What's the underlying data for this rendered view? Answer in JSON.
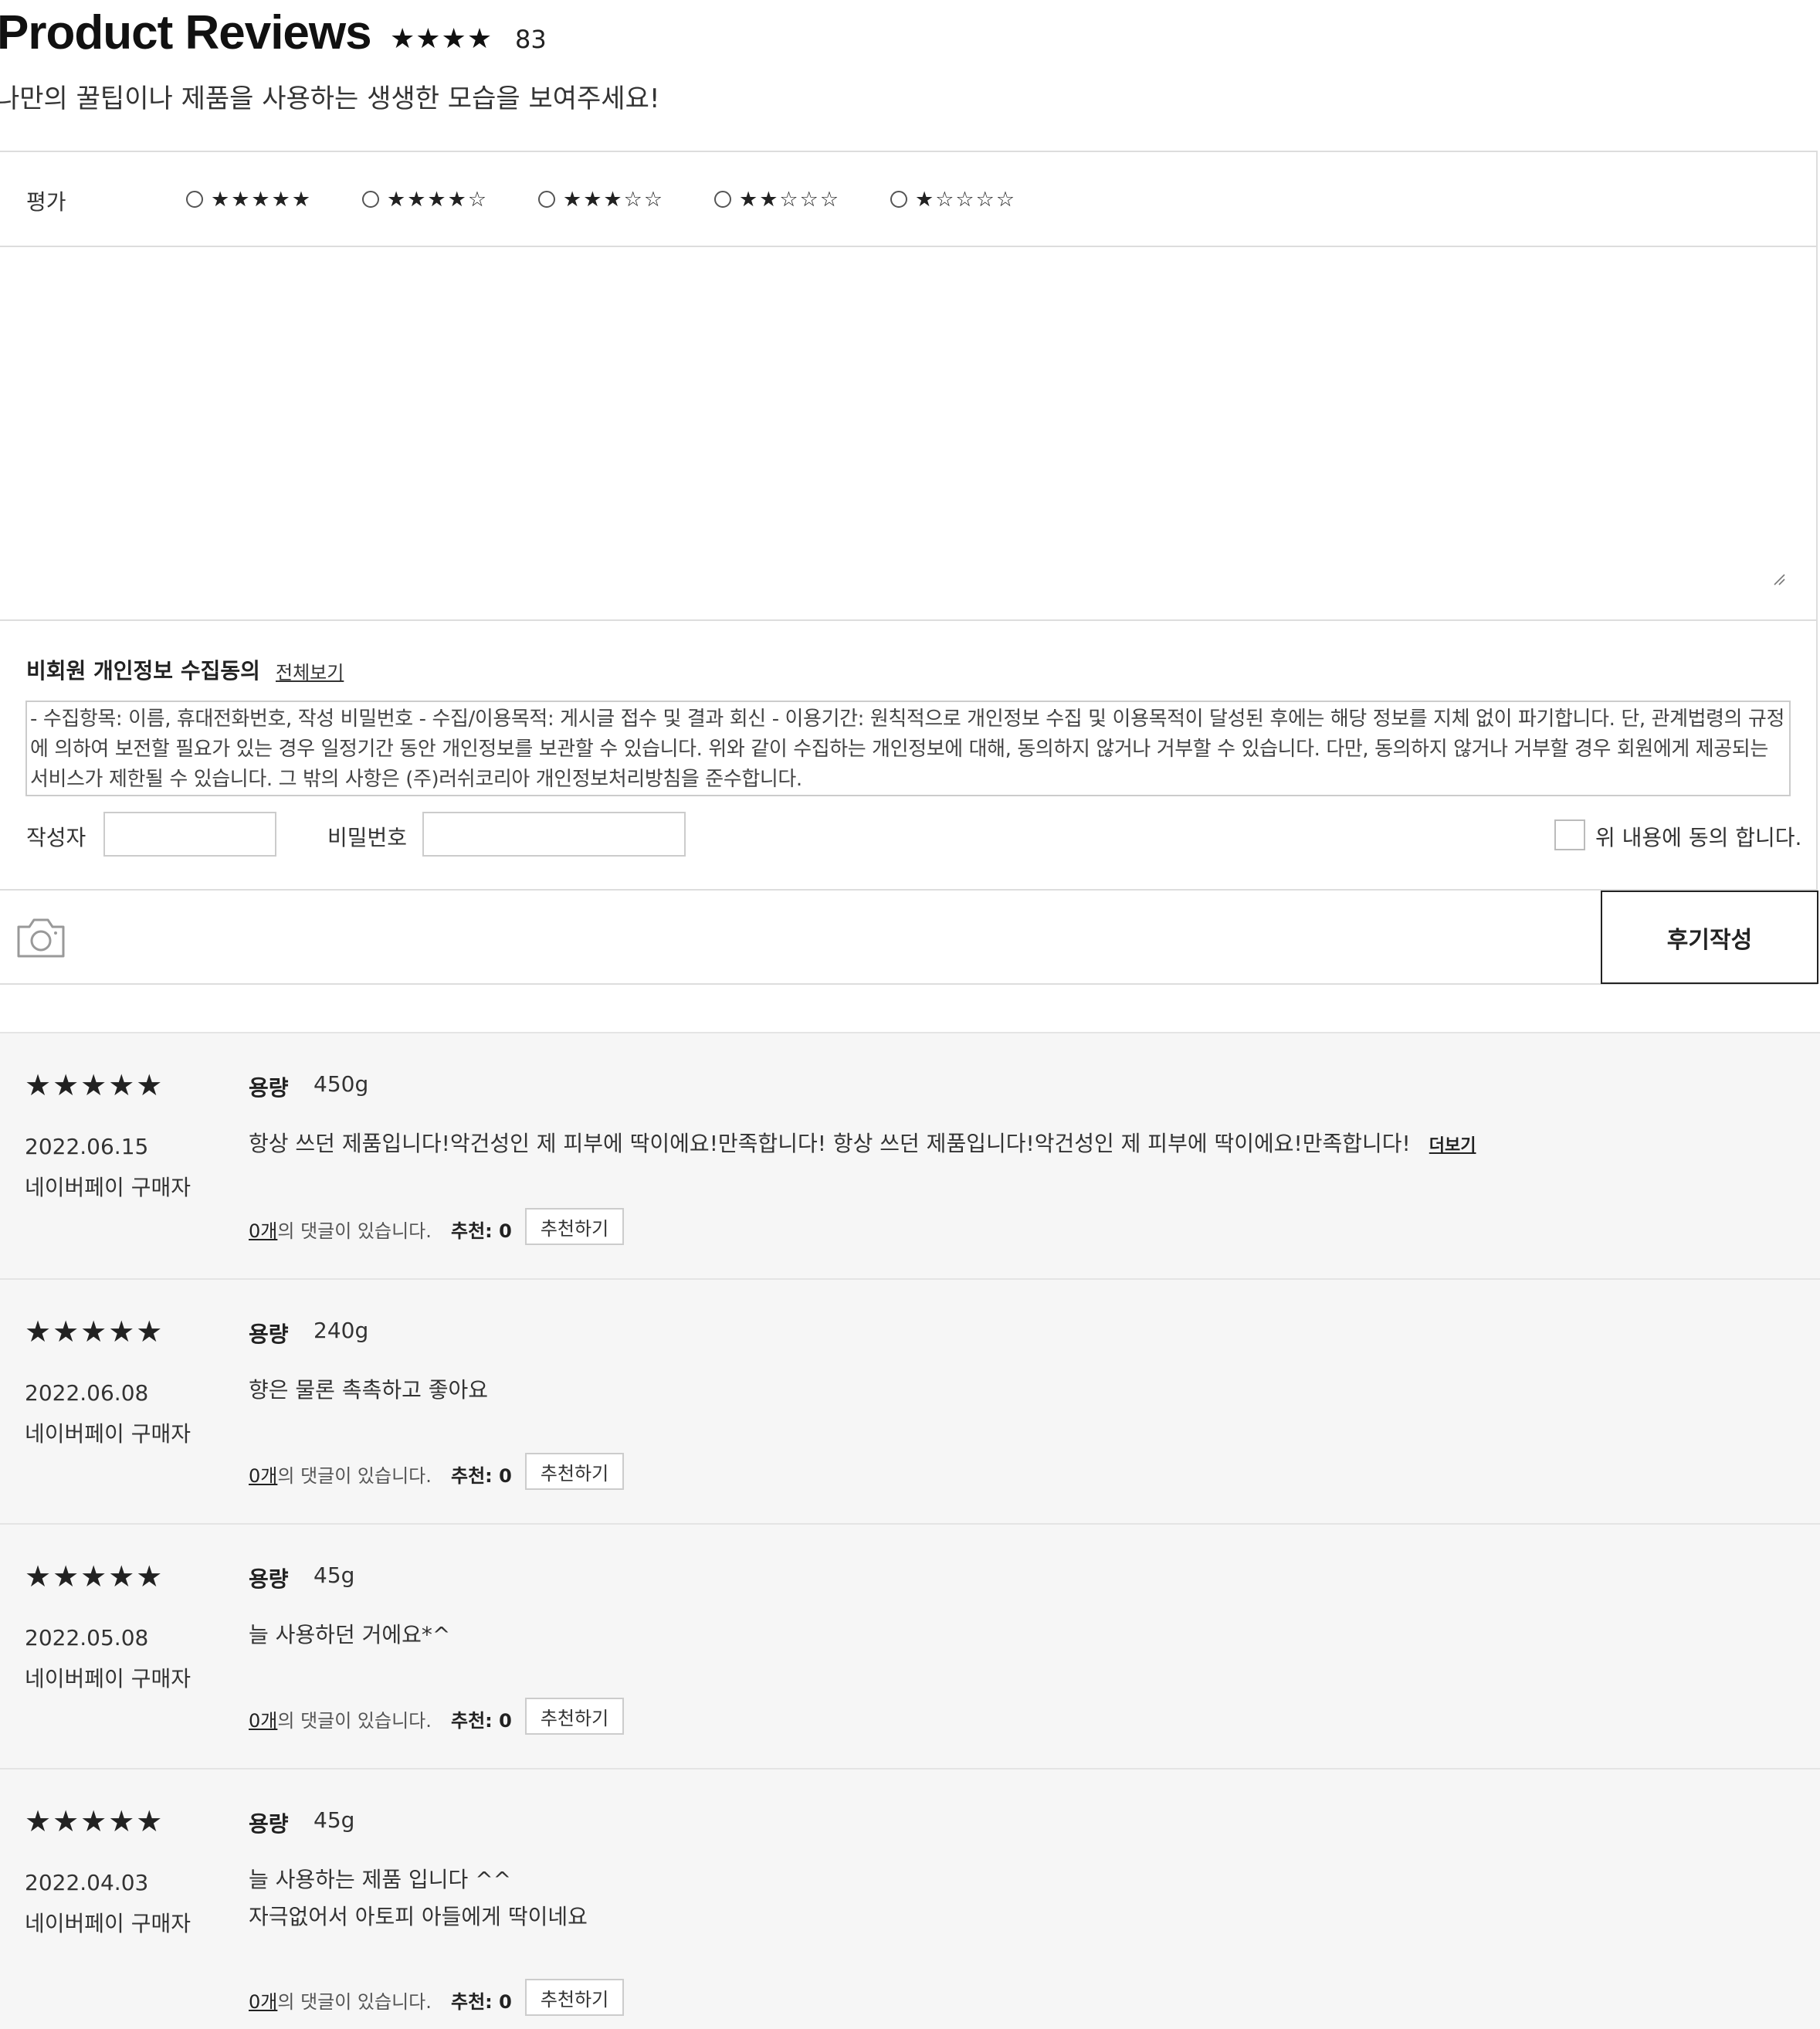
{
  "header": {
    "title": "Product Reviews",
    "rating_stars": "★★★★",
    "review_count": "83",
    "subtitle": "나만의 꿀팁이나 제품을 사용하는 생생한 모습을 보여주세요!"
  },
  "form": {
    "rating_label": "평가",
    "rating_options": [
      {
        "stars": "★★★★★"
      },
      {
        "stars": "★★★★☆"
      },
      {
        "stars": "★★★☆☆"
      },
      {
        "stars": "★★☆☆☆"
      },
      {
        "stars": "★☆☆☆☆"
      }
    ],
    "review_text_value": "",
    "consent_title": "비회원 개인정보 수집동의",
    "consent_view_all": "전체보기",
    "consent_text": "- 수집항목: 이름, 휴대전화번호, 작성 비밀번호 - 수집/이용목적: 게시글 접수 및 결과 회신 - 이용기간: 원칙적으로 개인정보 수집 및 이용목적이 달성된 후에는 해당 정보를 지체 없이 파기합니다. 단, 관계법령의 규정에 의하여 보전할 필요가 있는 경우 일정기간 동안 개인정보를 보관할 수 있습니다. 위와 같이 수집하는 개인정보에 대해, 동의하지 않거나 거부할 수 있습니다. 다만, 동의하지 않거나 거부할 경우 회원에게 제공되는 서비스가 제한될 수 있습니다. 그 밖의 사항은 (주)러쉬코리아 개인정보처리방침을 준수합니다.",
    "author_label": "작성자",
    "password_label": "비밀번호",
    "agree_label": "위 내용에 동의 합니다.",
    "camera_icon": "camera-icon",
    "submit_label": "후기작성"
  },
  "reviews": [
    {
      "stars": "★★★★★",
      "date": "2022.06.15",
      "buyer": "네이버페이 구매자",
      "option_label": "용량",
      "option_value": "450g",
      "lines": [
        "항상 쓰던 제품입니다!악건성인 제 피부에 딱이에요!만족합니다! 항상 쓰던 제품입니다!악건성인 제 피부에 딱이에요!만족합니다!"
      ],
      "more_label": "더보기",
      "comment_count": "0개",
      "comment_suffix": "의 댓글이 있습니다.",
      "recommend_count": "추천: 0",
      "recommend_button": "추천하기"
    },
    {
      "stars": "★★★★★",
      "date": "2022.06.08",
      "buyer": "네이버페이 구매자",
      "option_label": "용량",
      "option_value": "240g",
      "lines": [
        "향은 물론 촉촉하고 좋아요"
      ],
      "comment_count": "0개",
      "comment_suffix": "의 댓글이 있습니다.",
      "recommend_count": "추천: 0",
      "recommend_button": "추천하기"
    },
    {
      "stars": "★★★★★",
      "date": "2022.05.08",
      "buyer": "네이버페이 구매자",
      "option_label": "용량",
      "option_value": "45g",
      "lines": [
        "늘 사용하던 거에요*^"
      ],
      "comment_count": "0개",
      "comment_suffix": "의 댓글이 있습니다.",
      "recommend_count": "추천: 0",
      "recommend_button": "추천하기"
    },
    {
      "stars": "★★★★★",
      "date": "2022.04.03",
      "buyer": "네이버페이 구매자",
      "option_label": "용량",
      "option_value": "45g",
      "lines": [
        "늘 사용하는 제품 입니다 ^^",
        "자극없어서 아토피 아들에게 딱이네요"
      ],
      "comment_count": "0개",
      "comment_suffix": "의 댓글이 있습니다.",
      "recommend_count": "추천: 0",
      "recommend_button": "추천하기"
    }
  ]
}
